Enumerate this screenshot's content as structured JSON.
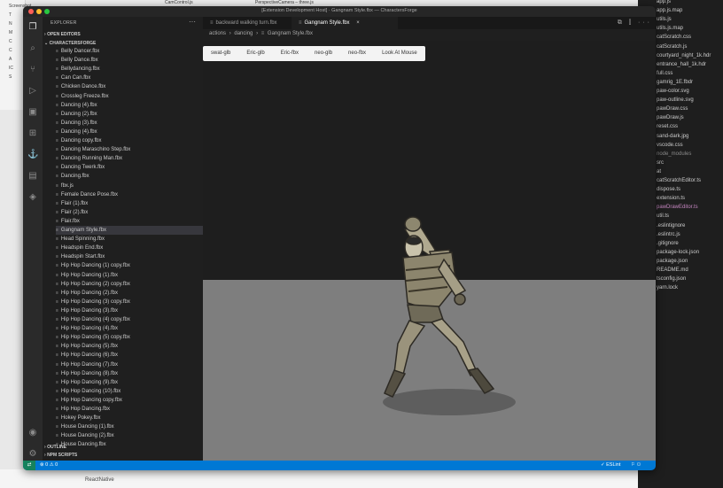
{
  "background": {
    "browser_tabs": [
      "CamControl.js",
      "PerspectiveCamera – three.js"
    ],
    "left_items": [
      "Screenshot",
      "T",
      "N",
      "M",
      "C",
      "C",
      "A",
      "IC",
      "S"
    ],
    "bottom_item": "ReactNative",
    "right_files": [
      {
        "label": "app.js",
        "style": "normal"
      },
      {
        "label": "app.js.map",
        "style": "normal"
      },
      {
        "label": "utils.js",
        "style": "normal"
      },
      {
        "label": "utils.js.map",
        "style": "normal"
      },
      {
        "label": "catScratch.css",
        "style": "normal"
      },
      {
        "label": "catScratch.js",
        "style": "normal"
      },
      {
        "label": "courtyard_night_1k.hdr",
        "style": "normal"
      },
      {
        "label": "entrance_hall_1k.hdr",
        "style": "normal"
      },
      {
        "label": "full.css",
        "style": "normal"
      },
      {
        "label": "gamrig_1E.fbdr",
        "style": "normal"
      },
      {
        "label": "paw-color.svg",
        "style": "normal"
      },
      {
        "label": "paw-outline.svg",
        "style": "normal"
      },
      {
        "label": "pawDraw.css",
        "style": "normal"
      },
      {
        "label": "pawDraw.js",
        "style": "normal"
      },
      {
        "label": "reset.css",
        "style": "normal"
      },
      {
        "label": "sand-dark.jpg",
        "style": "normal"
      },
      {
        "label": "vscode.css",
        "style": "normal"
      },
      {
        "label": "node_modules",
        "style": "dim"
      },
      {
        "label": "src",
        "style": "normal"
      },
      {
        "label": "at",
        "style": "normal"
      },
      {
        "label": "catScratchEditor.ts",
        "style": "normal"
      },
      {
        "label": "dispose.ts",
        "style": "normal"
      },
      {
        "label": "extension.ts",
        "style": "normal"
      },
      {
        "label": "pawDrawEditor.ts",
        "style": "highlight"
      },
      {
        "label": "util.ts",
        "style": "normal"
      },
      {
        "label": ".eslintignore",
        "style": "normal"
      },
      {
        "label": ".eslintrc.js",
        "style": "normal"
      },
      {
        "label": ".gitignore",
        "style": "normal"
      },
      {
        "label": "package-lock.json",
        "style": "normal"
      },
      {
        "label": "package.json",
        "style": "normal"
      },
      {
        "label": "README.md",
        "style": "normal"
      },
      {
        "label": "tsconfig.json",
        "style": "normal"
      },
      {
        "label": "yarn.lock",
        "style": "normal"
      }
    ]
  },
  "window": {
    "title": "[Extension Development Host] · Gangnam Style.fbx — CharactersForge",
    "traffic_colors": [
      "#ff5f57",
      "#febc2e",
      "#28c840"
    ]
  },
  "activity_bar": {
    "top": [
      {
        "icon": "files-icon",
        "glyph": "❐",
        "active": true
      },
      {
        "icon": "search-icon",
        "glyph": "⌕",
        "active": false
      },
      {
        "icon": "source-control-icon",
        "glyph": "⑂",
        "active": false
      },
      {
        "icon": "run-debug-icon",
        "glyph": "▷",
        "active": false
      },
      {
        "icon": "remote-explorer-icon",
        "glyph": "▣",
        "active": false
      },
      {
        "icon": "extensions-icon",
        "glyph": "⊞",
        "active": false
      },
      {
        "icon": "anchor-icon",
        "glyph": "⚓",
        "active": false
      },
      {
        "icon": "image-icon",
        "glyph": "▤",
        "active": false
      },
      {
        "icon": "docker-icon",
        "glyph": "◈",
        "active": false
      }
    ],
    "bottom": [
      {
        "icon": "account-icon",
        "glyph": "◉",
        "active": false
      },
      {
        "icon": "settings-gear-icon",
        "glyph": "⚙",
        "active": false
      }
    ]
  },
  "explorer": {
    "header": "EXPLORER",
    "more": "···",
    "open_editors": "OPEN EDITORS",
    "folder": "CHARACTERSFORGE",
    "file_icon": "≡",
    "files": [
      "Belly Dancer.fbx",
      "Belly Dance.fbx",
      "Bellydancing.fbx",
      "Can Can.fbx",
      "Chicken Dance.fbx",
      "Crossleg Freeze.fbx",
      "Dancing (4).fbx",
      "Dancing (2).fbx",
      "Dancing (3).fbx",
      "Dancing (4).fbx",
      "Dancing copy.fbx",
      "Dancing Maraschino Step.fbx",
      "Dancing Running Man.fbx",
      "Dancing Twerk.fbx",
      "Dancing.fbx",
      "fbx.js",
      "Female Dance Pose.fbx",
      "Flair (1).fbx",
      "Flair (2).fbx",
      "Flair.fbx",
      "Gangnam Style.fbx",
      "Head Spinning.fbx",
      "Headspin End.fbx",
      "Headspin Start.fbx",
      "Hip Hop Dancing (1) copy.fbx",
      "Hip Hop Dancing (1).fbx",
      "Hip Hop Dancing (2) copy.fbx",
      "Hip Hop Dancing (2).fbx",
      "Hip Hop Dancing (3) copy.fbx",
      "Hip Hop Dancing (3).fbx",
      "Hip Hop Dancing (4) copy.fbx",
      "Hip Hop Dancing (4).fbx",
      "Hip Hop Dancing (5) copy.fbx",
      "Hip Hop Dancing (5).fbx",
      "Hip Hop Dancing (6).fbx",
      "Hip Hop Dancing (7).fbx",
      "Hip Hop Dancing (8).fbx",
      "Hip Hop Dancing (9).fbx",
      "Hip Hop Dancing (10).fbx",
      "Hip Hop Dancing copy.fbx",
      "Hip Hop Dancing.fbx",
      "Hokey Pokey.fbx",
      "House Dancing (1).fbx",
      "House Dancing (2).fbx",
      "House Dancing.fbx"
    ],
    "selected": 20,
    "outline": "OUTLINE",
    "npm_scripts": "NPM SCRIPTS"
  },
  "editor": {
    "tabs": [
      {
        "label": "backward walking turn.fbx",
        "active": false
      },
      {
        "label": "Gangnam Style.fbx",
        "active": true
      }
    ],
    "tab_close": "×",
    "actions": "⧉ ⫿ ···",
    "breadcrumb": [
      "actions",
      "dancing",
      "Gangnam Style.fbx"
    ],
    "crumb_sep": "›",
    "viewer_buttons": [
      "swat-glb",
      "Eric-glb",
      "Eric-fbx",
      "neo-glb",
      "neo-fbx",
      "Look At Mouse"
    ]
  },
  "status_bar": {
    "remote": "⇄",
    "problems": "⊗ 0 ⚠ 0",
    "eslint": "✓ ESLint",
    "icons": "⚐ ⚇"
  }
}
